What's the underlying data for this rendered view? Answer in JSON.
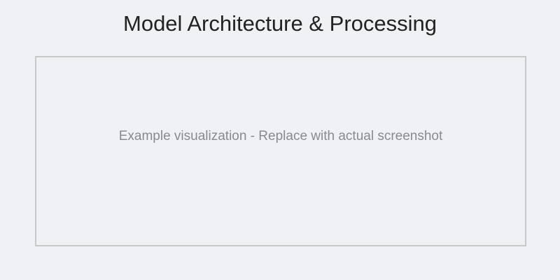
{
  "title": "Model Architecture & Processing",
  "placeholder": {
    "text": "Example visualization - Replace with actual screenshot"
  },
  "colors": {
    "background": "#f0f1f5",
    "title": "#222222",
    "placeholder_border": "#c8c8ca",
    "placeholder_text": "#8a8a8e"
  }
}
